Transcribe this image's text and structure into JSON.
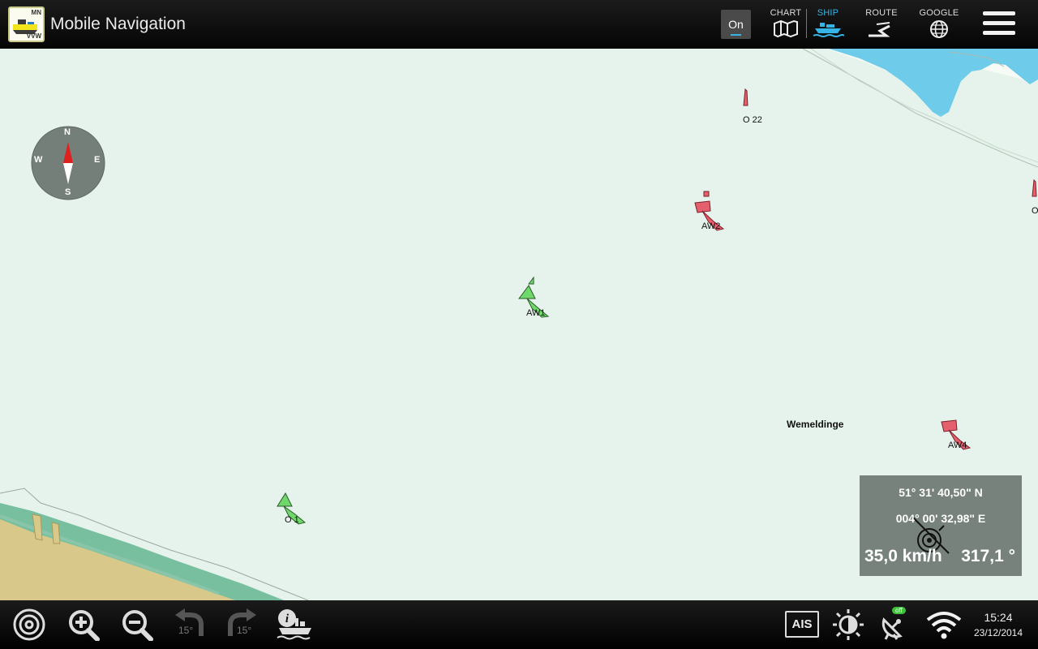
{
  "header": {
    "title": "Mobile Navigation",
    "logo_top": "MN",
    "logo_bottom": "VVW",
    "toggle_label": "On",
    "modes": [
      {
        "label": "CHART",
        "icon": "map-icon",
        "active": false
      },
      {
        "label": "SHIP",
        "icon": "ship-icon",
        "active": true
      },
      {
        "label": "ROUTE",
        "icon": "route-icon",
        "active": false
      },
      {
        "label": "GOOGLE",
        "icon": "globe-icon",
        "active": false
      }
    ],
    "menu_icon": "hamburger-menu-icon"
  },
  "map": {
    "compass": {
      "n": "N",
      "e": "E",
      "s": "S",
      "w": "W"
    },
    "buoys": [
      {
        "label": "O 22",
        "color": "red"
      },
      {
        "label": "AW2",
        "color": "red"
      },
      {
        "label": "O",
        "color": "red"
      },
      {
        "label": "AW1",
        "color": "green"
      },
      {
        "label": "AW4",
        "color": "red"
      },
      {
        "label": "O 1",
        "color": "green"
      }
    ],
    "place_name": "Wemeldinge",
    "colors": {
      "water": "#e6f3ec",
      "land": "#d8c98a",
      "shallow": "#6fcbea",
      "red_buoy": "#e4606d",
      "green_buoy": "#6fd86a"
    }
  },
  "position": {
    "latitude": "51° 31' 40,50\" N",
    "longitude": "004° 00' 32,98\" E",
    "speed": "35,0 km/h",
    "heading": "317,1 °"
  },
  "toolbar": {
    "rotate_left_label": "15°",
    "rotate_right_label": "15°",
    "ais_label": "AIS",
    "gps_badge": "off"
  },
  "status": {
    "time": "15:24",
    "date": "23/12/2014"
  }
}
